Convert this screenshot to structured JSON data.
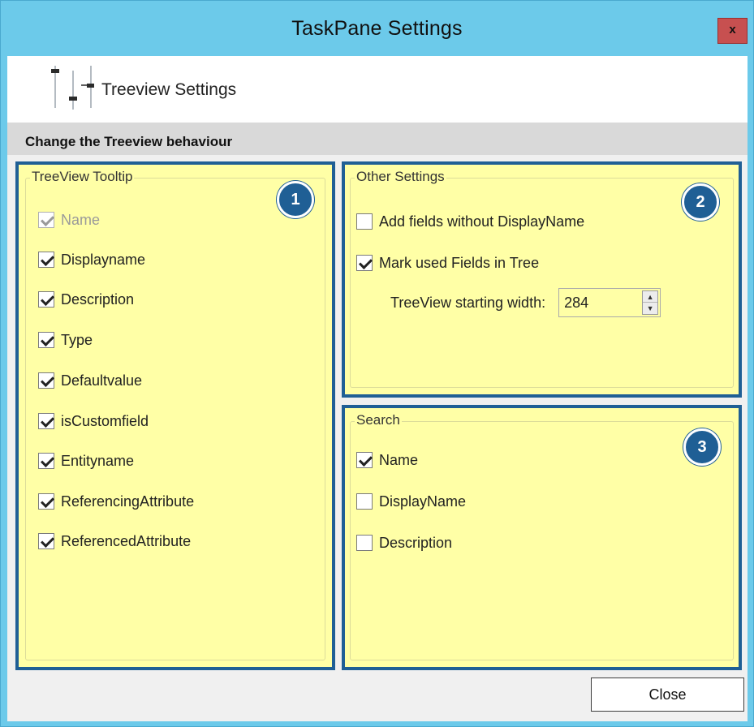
{
  "window": {
    "title": "TaskPane Settings",
    "close_glyph": "x"
  },
  "header": {
    "icon": "sliders-icon",
    "title": "Treeview Settings",
    "subtitle": "Change the Treeview behaviour"
  },
  "panel_tooltip": {
    "badge": "1",
    "legend": "TreeView Tooltip",
    "items": [
      {
        "label": "Name",
        "checked": true,
        "disabled": true
      },
      {
        "label": "Displayname",
        "checked": true,
        "disabled": false
      },
      {
        "label": "Description",
        "checked": true,
        "disabled": false
      },
      {
        "label": "Type",
        "checked": true,
        "disabled": false
      },
      {
        "label": "Defaultvalue",
        "checked": true,
        "disabled": false
      },
      {
        "label": "isCustomfield",
        "checked": true,
        "disabled": false
      },
      {
        "label": "Entityname",
        "checked": true,
        "disabled": false
      },
      {
        "label": "ReferencingAttribute",
        "checked": true,
        "disabled": false
      },
      {
        "label": "ReferencedAttribute",
        "checked": true,
        "disabled": false
      }
    ]
  },
  "panel_other": {
    "badge": "2",
    "legend": "Other Settings",
    "items": [
      {
        "label": "Add fields without DisplayName",
        "checked": false
      },
      {
        "label": "Mark used Fields in Tree",
        "checked": true
      }
    ],
    "spinner": {
      "label": "TreeView starting width:",
      "value": "284"
    }
  },
  "panel_search": {
    "badge": "3",
    "legend": "Search",
    "items": [
      {
        "label": "Name",
        "checked": true
      },
      {
        "label": "DisplayName",
        "checked": false
      },
      {
        "label": "Description",
        "checked": false
      }
    ]
  },
  "footer": {
    "close_label": "Close"
  },
  "colors": {
    "titlebar": "#6ccaea",
    "panel_fill": "#ffffa6",
    "panel_border": "#1f5f95",
    "badge": "#1f5f95",
    "close_x": "#c75050"
  }
}
